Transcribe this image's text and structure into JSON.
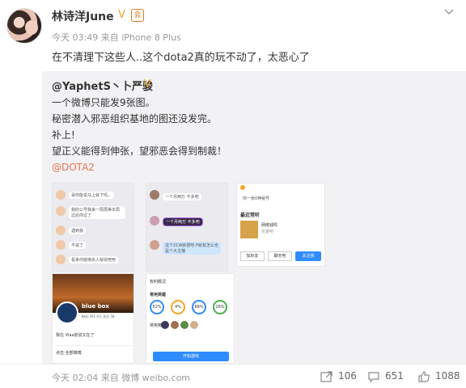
{
  "post": {
    "username": "林诗洋June",
    "meta": "今天 03:49 来自 iPhone 8 Plus",
    "text": "在不清理下这些人..这个dota2真的玩不动了，太恶心了"
  },
  "repost": {
    "author": "@YaphetS丶卜严骏",
    "lines": [
      "一个微博只能发9张图。",
      "秘密潜入邪恶组织基地的图还没发完。",
      "补上!",
      "望正义能得到伸张，望邪恶会得到制裁！"
    ],
    "link": "@DOTA2",
    "thumbs": {
      "t1": [
        "哥你能说马上就下吗，",
        "我的公号我来一局再等本局过后你过了",
        "遇到我",
        "不说了",
        "看来你能够杀人就快死吧"
      ],
      "t2": [
        "一个月两万 不多吧",
        "一个月两万 不多吧",
        "这个21W就很吧 P就有怎么也是个大主播"
      ],
      "t3": {
        "line1": "你一张0神秘号",
        "section": "最近常听",
        "song": "网络钱吹",
        "song_sub": "花姜吧",
        "btn1": "加好友",
        "btn2": "聊天吧",
        "btn3": "关注我"
      },
      "t4": {
        "name": "blue box",
        "sub": "粉丝:201 4万 关注 58",
        "row1": "我在 Vlaa前说又在了",
        "row2": "点击 全部微博"
      },
      "t5": {
        "title": "权利概况",
        "title2": "常用英雄",
        "pcts": [
          "52%",
          "4%",
          "68%",
          "26%"
        ],
        "section": "常用英雄",
        "button": "开始游戏"
      }
    }
  },
  "footer": {
    "meta": "今天 02:04 来自 微博 weibo.com",
    "reposts": "106",
    "comments": "651",
    "likes": "1088"
  }
}
